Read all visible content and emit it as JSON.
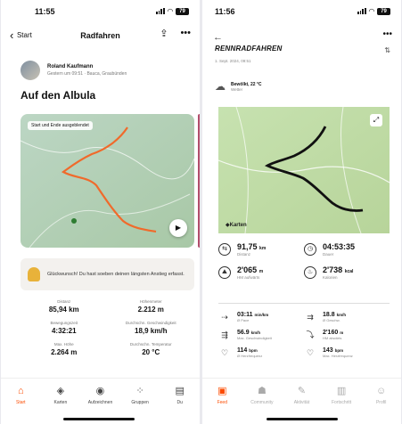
{
  "left": {
    "status_time": "11:55",
    "battery": "79",
    "nav": {
      "back_label": "Start",
      "title": "Radfahren"
    },
    "user": {
      "name": "Roland Kaufmann",
      "meta": "Gestern um 09:51 · Bauca, Graubünden"
    },
    "activity_title": "Auf den Albula",
    "map_label": "Start und Ende ausgeblendet",
    "banner_text": "Glückwunsch! Du hast soeben deinen längsten Anstieg erfasst.",
    "stats": [
      {
        "label": "Distanz",
        "value": "85,94 km"
      },
      {
        "label": "Höhenmeter",
        "value": "2.212 m"
      },
      {
        "label": "Bewegungszeit",
        "value": "4:32:21"
      },
      {
        "label": "Durchschn. Geschwindigkeit",
        "value": "18,9 km/h"
      },
      {
        "label": "Max. Höhe",
        "value": "2.264 m"
      },
      {
        "label": "Durchschn. Temperatur",
        "value": "20 °C"
      }
    ],
    "tabs": [
      {
        "label": "Start",
        "icon": "home-icon",
        "glyph": "⌂"
      },
      {
        "label": "Karten",
        "icon": "maps-icon",
        "glyph": "◈"
      },
      {
        "label": "Aufzeichnen",
        "icon": "record-icon",
        "glyph": "◉"
      },
      {
        "label": "Gruppen",
        "icon": "groups-icon",
        "glyph": "⁘"
      },
      {
        "label": "Du",
        "icon": "profile-icon",
        "glyph": "▤"
      }
    ]
  },
  "right": {
    "status_time": "11:56",
    "battery": "79",
    "activity_title": "RENNRADFAHREN",
    "date": "1. Sept. 2024, 09:51",
    "weather_main": "Bewölkt, 22 °C",
    "weather_sub": "Wetter",
    "map_credit": "Karten",
    "stats": [
      {
        "value": "91,75",
        "unit": "km",
        "label": "Distanz",
        "icon": "route-icon",
        "glyph": "⇆"
      },
      {
        "value": "04:53:35",
        "unit": "",
        "label": "Dauer",
        "icon": "clock-icon",
        "glyph": "◷"
      },
      {
        "value": "2'065",
        "unit": "m",
        "label": "HM aufwärts",
        "icon": "mountain-icon",
        "glyph": "⛰"
      },
      {
        "value": "2'738",
        "unit": "kcal",
        "label": "Kalorien",
        "icon": "flame-icon",
        "glyph": "♨"
      }
    ],
    "stats2": [
      {
        "value": "03:11",
        "unit": "min/km",
        "label": "Ø Pace",
        "icon": "pace-icon",
        "glyph": "⇢"
      },
      {
        "value": "18.8",
        "unit": "km/h",
        "label": "Ø Geschw.",
        "icon": "speed-icon",
        "glyph": "⇉"
      },
      {
        "value": "56.9",
        "unit": "km/h",
        "label": "Max. Geschwindigkeit",
        "icon": "max-speed-icon",
        "glyph": "⇶"
      },
      {
        "value": "2'160",
        "unit": "m",
        "label": "HM abwärts",
        "icon": "descent-icon",
        "glyph": "⤵"
      },
      {
        "value": "114",
        "unit": "bpm",
        "label": "Ø Herzfrequenz",
        "icon": "heart-icon",
        "glyph": "♡"
      },
      {
        "value": "143",
        "unit": "bpm",
        "label": "Max. Herzfrequenz",
        "icon": "heart-max-icon",
        "glyph": "♡"
      }
    ],
    "tabs": [
      {
        "label": "Feed",
        "icon": "feed-icon",
        "glyph": "▣"
      },
      {
        "label": "Community",
        "icon": "community-icon",
        "glyph": "☗"
      },
      {
        "label": "Aktivität",
        "icon": "activity-icon",
        "glyph": "✎"
      },
      {
        "label": "Fortschritt",
        "icon": "progress-icon",
        "glyph": "▥"
      },
      {
        "label": "Profil",
        "icon": "profile-icon",
        "glyph": "☺"
      }
    ]
  },
  "colors": {
    "accent": "#fc4c02",
    "route": "#f06a2b",
    "track": "#111111"
  }
}
